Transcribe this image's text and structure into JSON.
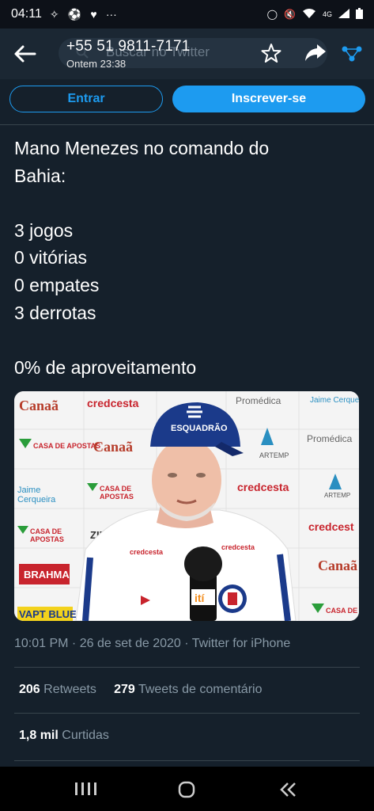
{
  "status_bar": {
    "time": "04:11",
    "network": "4G",
    "dots": "···"
  },
  "header": {
    "search_placeholder": "Buscar no Twitter",
    "contact_name": "+55 51 9811-7171",
    "contact_time": "Ontem 23:38"
  },
  "buttons": {
    "login": "Entrar",
    "signup": "Inscrever-se"
  },
  "tweet": {
    "lines": [
      "Mano Menezes no comando do",
      "Bahia:",
      "",
      "3 jogos",
      "0 vitórias",
      "0 empates",
      "3 derrotas",
      "",
      "0% de aproveitamento"
    ],
    "timestamp": "10:01 PM · 26 de set de 2020 · Twitter for iPhone",
    "retweets_count": "206",
    "retweets_label": "Retweets",
    "comments_count": "279",
    "comments_label": "Tweets de comentário",
    "likes_count": "1,8 mil",
    "likes_label": "Curtidas"
  },
  "photo": {
    "cap_text": "ESQUADRÃO",
    "sponsors": [
      "Canaã",
      "credcesta",
      "Promédica",
      "Jaime Cerqueira",
      "CASA DE APOSTAS",
      "ARTEMP",
      "BRAHMA",
      "VAPT BLUE",
      "ZINZ"
    ]
  }
}
